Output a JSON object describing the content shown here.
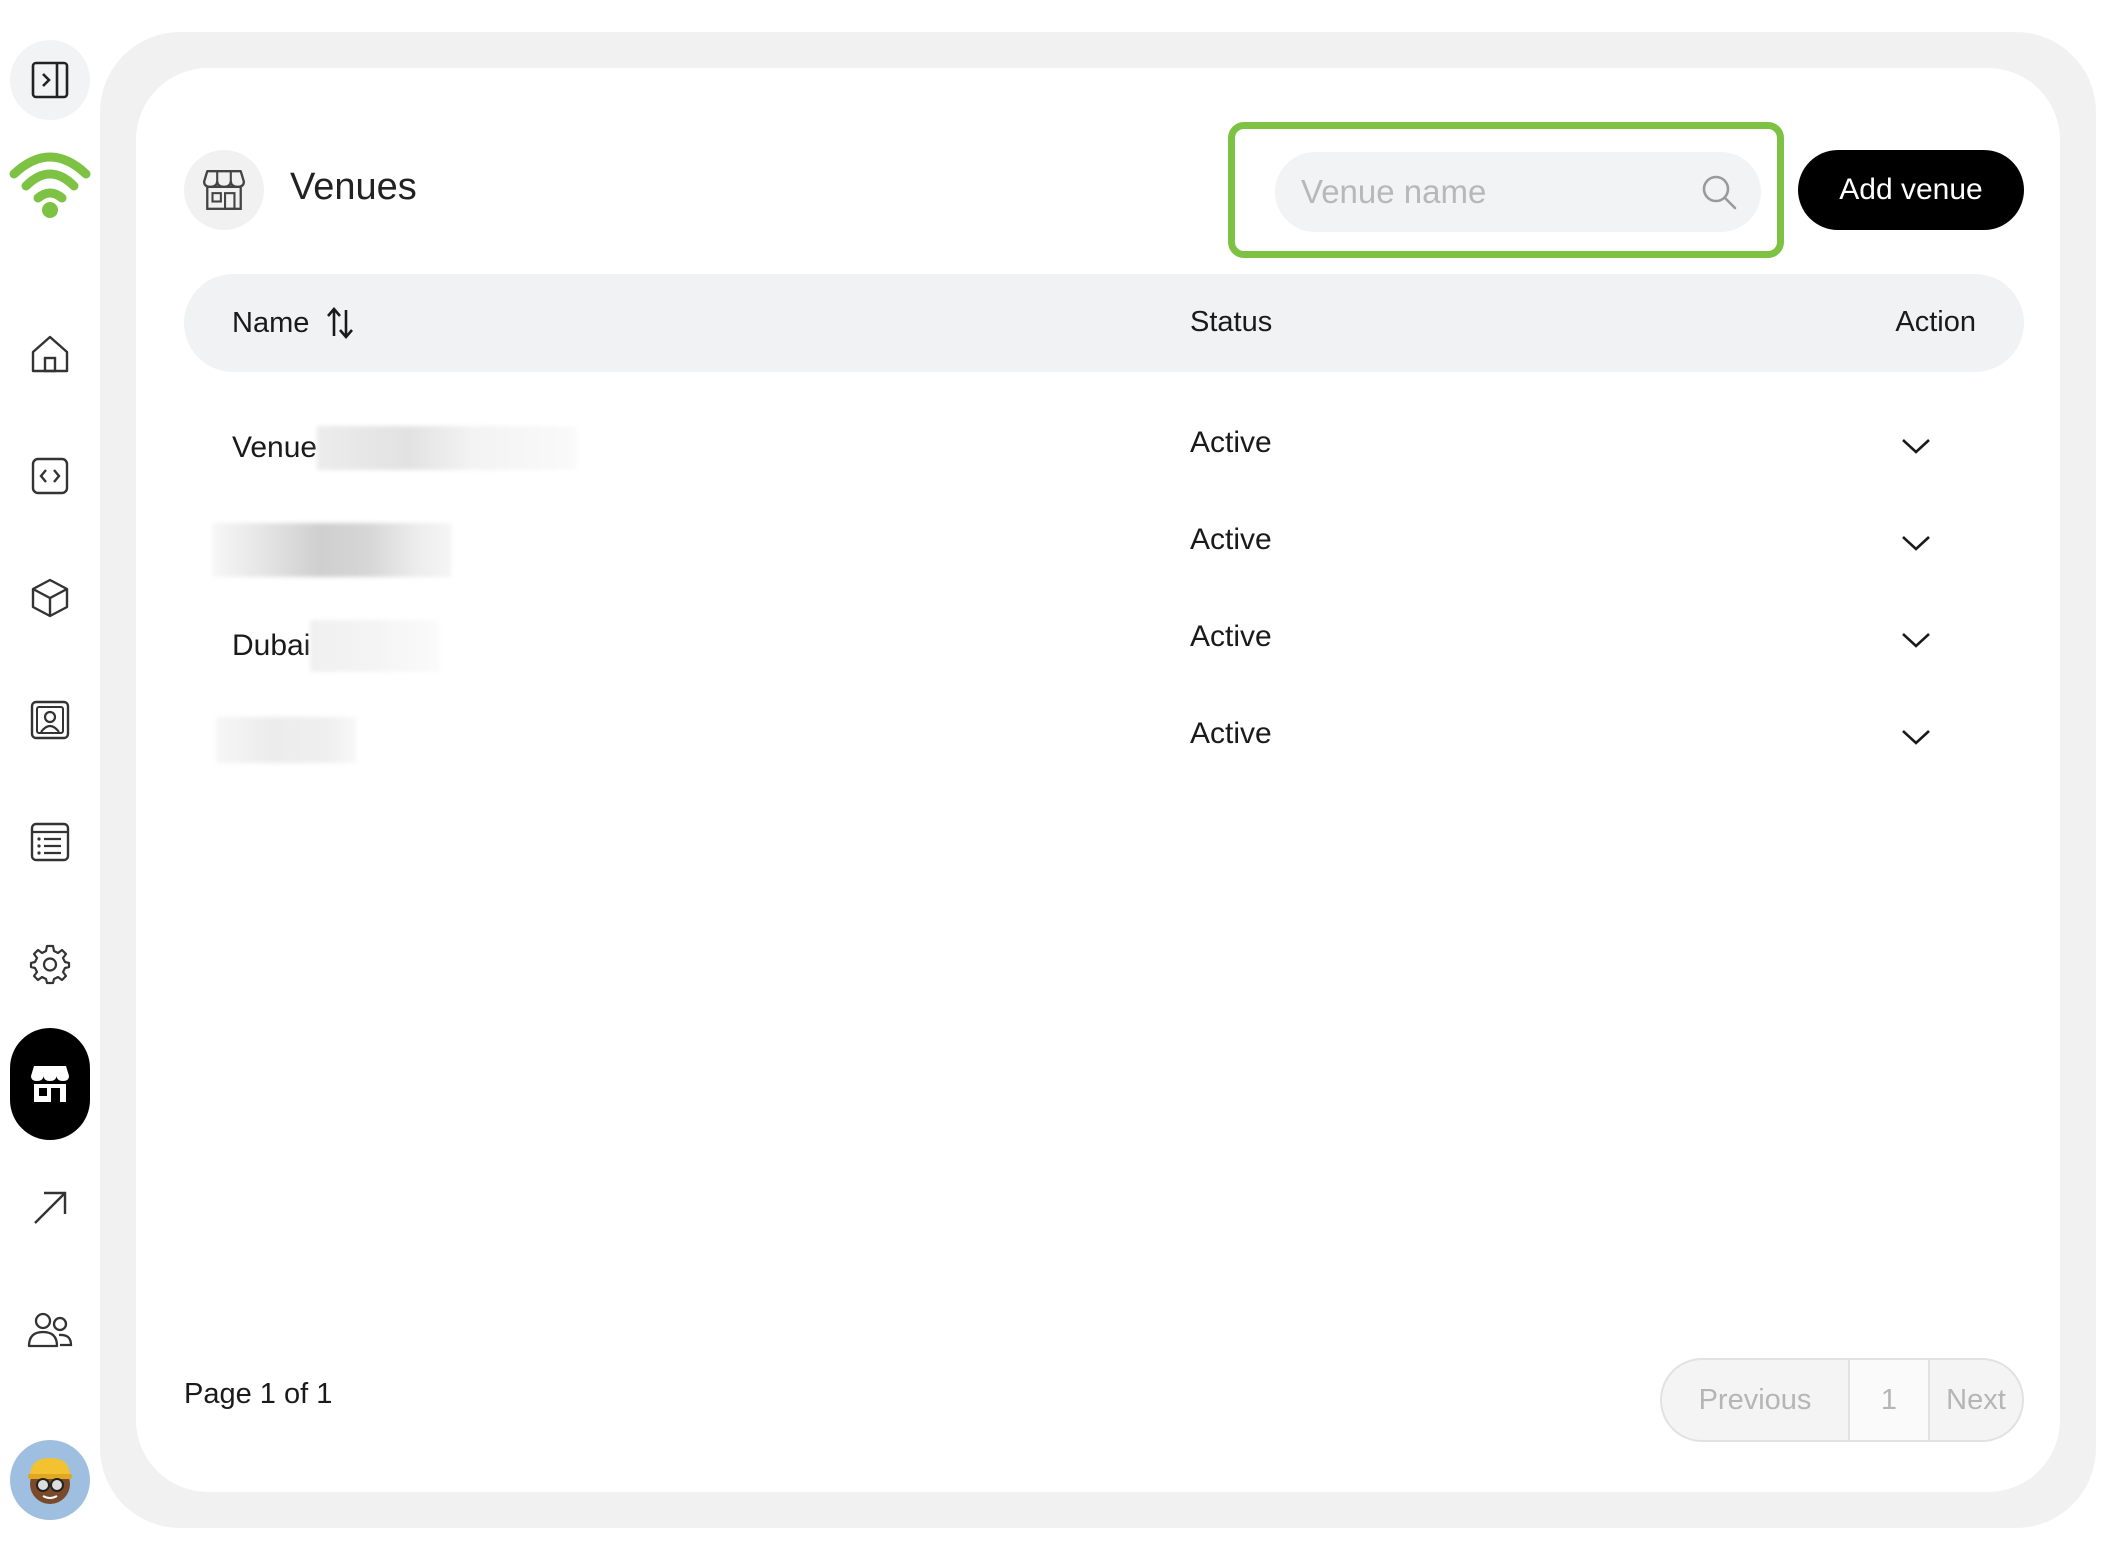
{
  "header": {
    "title": "Venues",
    "search_placeholder": "Venue name",
    "add_label": "Add venue"
  },
  "table": {
    "columns": {
      "name": "Name",
      "status": "Status",
      "action": "Action"
    },
    "rows": [
      {
        "name": "Venue",
        "status": "Active"
      },
      {
        "name": "",
        "status": "Active"
      },
      {
        "name": "Dubai",
        "status": "Active"
      },
      {
        "name": "",
        "status": "Active"
      }
    ]
  },
  "footer": {
    "page_info": "Page 1 of 1",
    "prev_label": "Previous",
    "current_page": "1",
    "next_label": "Next"
  },
  "colors": {
    "accent": "#7dc242",
    "active_nav": "#000000",
    "panel": "#f1f1f1"
  },
  "icons": {
    "sidebar": [
      "panel-toggle-icon",
      "wifi-logo-icon",
      "home-icon",
      "code-icon",
      "box-icon",
      "contact-icon",
      "list-icon",
      "gear-icon",
      "store-icon",
      "arrow-up-right-icon",
      "users-icon"
    ]
  }
}
